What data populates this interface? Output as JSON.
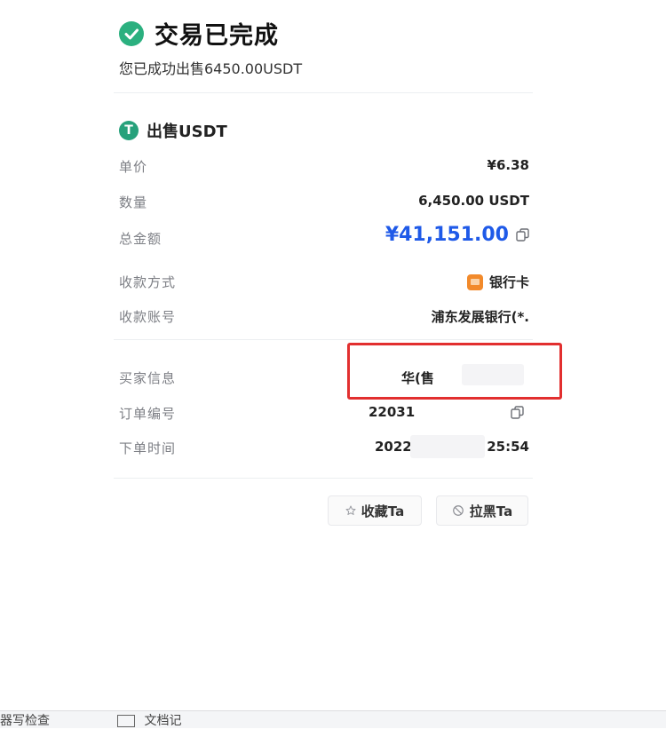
{
  "header": {
    "title": "交易已完成",
    "subtitle": "您已成功出售6450.00USDT"
  },
  "order": {
    "section_title": "出售USDT",
    "tether_symbol": "T",
    "rows": {
      "unit_price": {
        "label": "单价",
        "value": "¥6.38"
      },
      "quantity": {
        "label": "数量",
        "value": "6,450.00 USDT"
      },
      "total": {
        "label": "总金额",
        "value": "¥41,151.00"
      },
      "payment_method": {
        "label": "收款方式",
        "value": "银行卡"
      },
      "account": {
        "label": "收款账号",
        "value": "浦东发展银行(*."
      },
      "buyer": {
        "label": "买家信息",
        "value": "华(售"
      },
      "order_no": {
        "label": "订单编号",
        "value": "22031"
      },
      "order_time": {
        "label": "下单时间",
        "value_prefix": "2022",
        "value_suffix": "25:54"
      }
    }
  },
  "actions": {
    "favorite_label": "收藏Ta",
    "block_label": "拉黑Ta"
  },
  "colors": {
    "accent_blue": "#1f5ae8",
    "success_green": "#2bb07f",
    "tether_green": "#26a17b",
    "bank_orange": "#f28a2b",
    "redact_red": "#e22f2f"
  },
  "icons": {
    "success": "check-circle-icon",
    "currency": "tether-icon",
    "copy": "copy-icon",
    "bank": "bank-card-icon",
    "favorite": "star-icon",
    "block": "block-icon"
  },
  "bottom_fragments": {
    "left": "器写检查",
    "middle": "文档记"
  }
}
